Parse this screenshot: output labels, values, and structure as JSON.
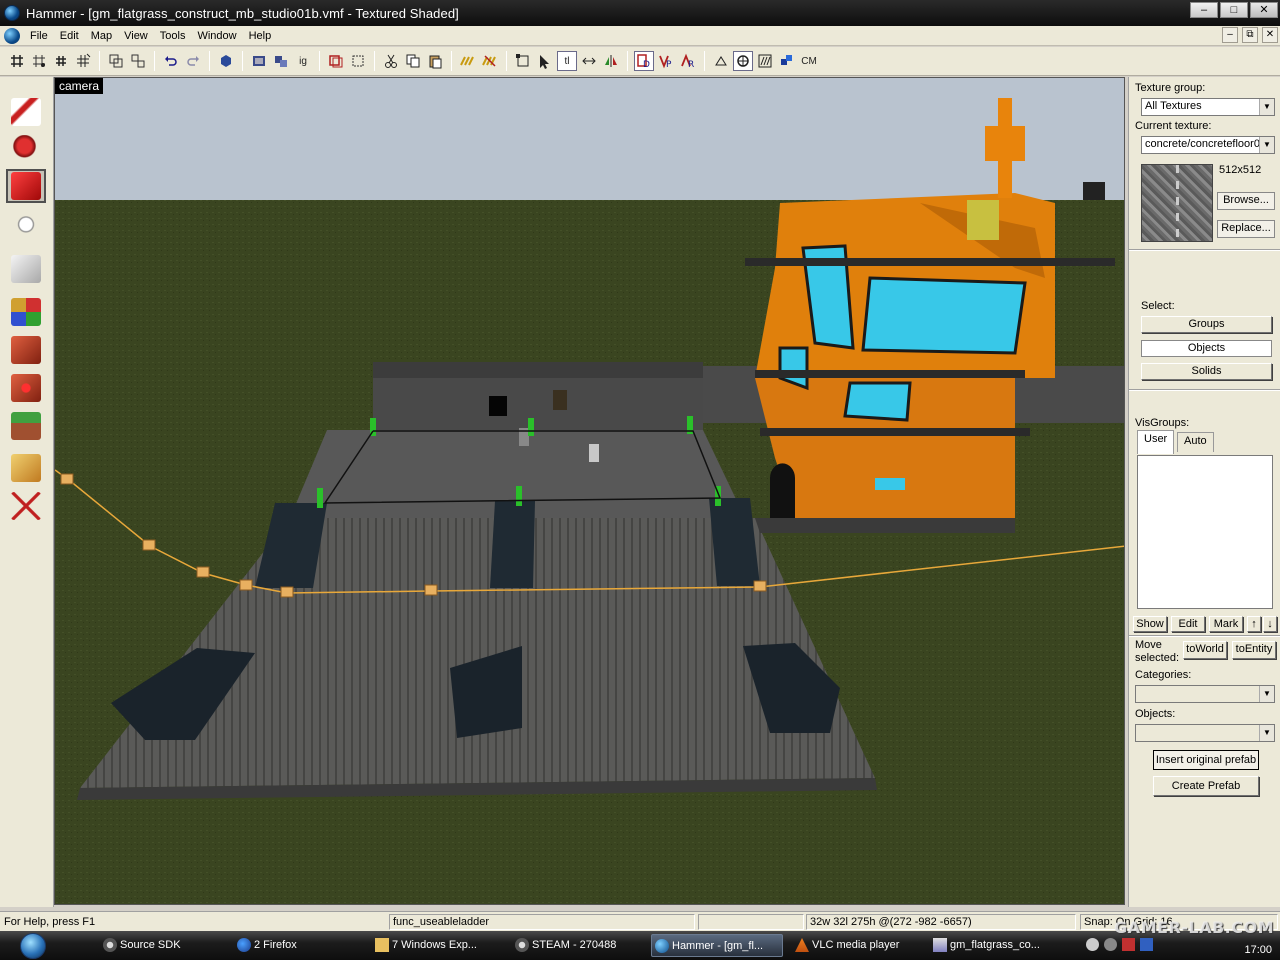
{
  "window": {
    "title": "Hammer - [gm_flatgrass_construct_mb_studio01b.vmf - Textured Shaded]",
    "controls": [
      "–",
      "□",
      "✕"
    ]
  },
  "menubar": {
    "items": [
      "File",
      "Edit",
      "Map",
      "View",
      "Tools",
      "Window",
      "Help"
    ],
    "mdi_controls": [
      "–",
      "⧉",
      "✕"
    ]
  },
  "toolbar": {
    "text_buttons": [
      "ig",
      "tl",
      "CM"
    ]
  },
  "viewport": {
    "label": "camera"
  },
  "texture_panel": {
    "group_label": "Texture group:",
    "group_value": "All Textures",
    "current_label": "Current texture:",
    "current_value": "concrete/concretefloor0",
    "size": "512x512",
    "browse": "Browse...",
    "replace": "Replace..."
  },
  "select_panel": {
    "label": "Select:",
    "groups": "Groups",
    "objects": "Objects",
    "solids": "Solids"
  },
  "visgroups": {
    "label": "VisGroups:",
    "tab_user": "User",
    "tab_auto": "Auto",
    "show": "Show",
    "edit": "Edit",
    "mark": "Mark",
    "up": "↑",
    "down": "↓"
  },
  "move_panel": {
    "label_line1": "Move",
    "label_line2": "selected:",
    "to_world": "toWorld",
    "to_entity": "toEntity"
  },
  "prefab_panel": {
    "categories_label": "Categories:",
    "objects_label": "Objects:",
    "insert": "Insert original prefab",
    "create": "Create Prefab"
  },
  "statusbar": {
    "help": "For Help, press F1",
    "entity": "func_useableladder",
    "coords": "32w 32l 275h @(272 -982 -6657)",
    "snap": "Snap: On Grid: 16"
  },
  "taskbar": {
    "tasks": [
      {
        "label": "Source SDK"
      },
      {
        "label": "2 Firefox"
      },
      {
        "label": "7 Windows Exp..."
      },
      {
        "label": "STEAM - 270488"
      },
      {
        "label": "Hammer - [gm_fl..."
      },
      {
        "label": "VLC media player"
      },
      {
        "label": "gm_flatgrass_co..."
      }
    ],
    "clock": "17:00"
  },
  "watermark": "GAMER-LAB.COM",
  "colors": {
    "sky": "#b9c3cf",
    "grass": "#3a4520",
    "tower_orange": "#e0800c",
    "glass": "#38c8e8",
    "rope": "#e8a83a"
  }
}
